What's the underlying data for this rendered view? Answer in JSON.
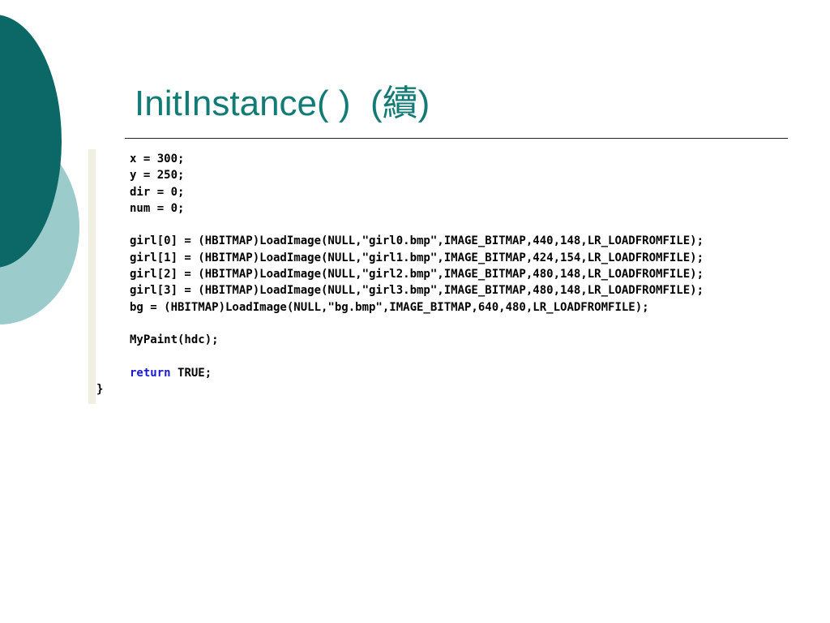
{
  "slide": {
    "title": "InitInstance( )  (續)"
  },
  "code": {
    "lines": [
      "x = 300;",
      "y = 250;",
      "dir = 0;",
      "num = 0;",
      "",
      "girl[0] = (HBITMAP)LoadImage(NULL,\"girl0.bmp\",IMAGE_BITMAP,440,148,LR_LOADFROMFILE);",
      "girl[1] = (HBITMAP)LoadImage(NULL,\"girl1.bmp\",IMAGE_BITMAP,424,154,LR_LOADFROMFILE);",
      "girl[2] = (HBITMAP)LoadImage(NULL,\"girl2.bmp\",IMAGE_BITMAP,480,148,LR_LOADFROMFILE);",
      "girl[3] = (HBITMAP)LoadImage(NULL,\"girl3.bmp\",IMAGE_BITMAP,480,148,LR_LOADFROMFILE);",
      "bg = (HBITMAP)LoadImage(NULL,\"bg.bmp\",IMAGE_BITMAP,640,480,LR_LOADFROMFILE);",
      "",
      "MyPaint(hdc);",
      "",
      "TRUE;",
      "}"
    ],
    "return_keyword": "return"
  },
  "colors": {
    "title": "#137b76",
    "circle_dark": "#0c6866",
    "circle_light": "#9ccbcb",
    "keyword": "#1a1ad0",
    "gutter": "#f1efe2"
  }
}
